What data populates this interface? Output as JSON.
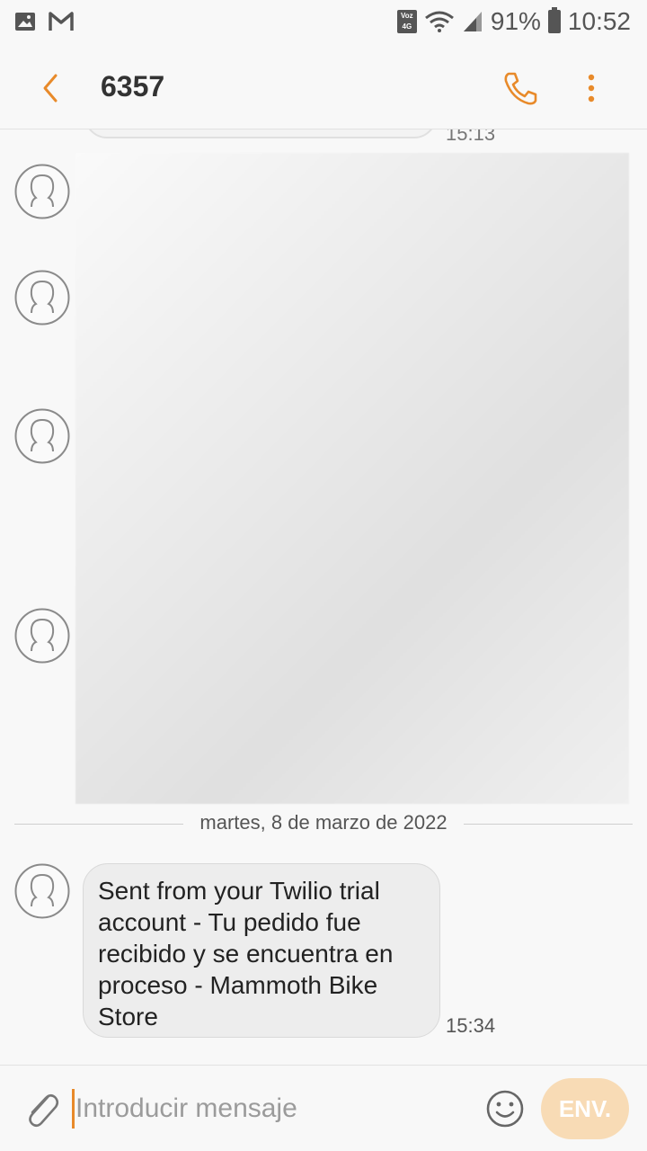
{
  "status_bar": {
    "network_badge": "Voz 4G",
    "battery_percent": "91%",
    "time": "10:52",
    "left_icons": [
      "gallery-icon",
      "gmail-icon"
    ],
    "right_icons": [
      "volte-icon",
      "wifi-icon",
      "signal-icon",
      "battery-icon"
    ]
  },
  "header": {
    "title": "6357",
    "icons": [
      "back-icon",
      "phone-icon",
      "more-icon"
    ]
  },
  "conversation": {
    "previous_time": "15:13",
    "date_divider": "martes, 8 de marzo de 2022",
    "message": {
      "text": "Sent from your Twilio trial account - Tu pedido fue recibido y se encuentra en proceso - Mammoth Bike Store",
      "time": "15:34"
    }
  },
  "composer": {
    "placeholder": "Introducir mensaje",
    "send_label": "ENV.",
    "icons": [
      "attach-icon",
      "emoji-icon"
    ]
  },
  "colors": {
    "accent": "#e88a2a",
    "send_disabled": "#f8dbb5",
    "bubble": "#ededed"
  }
}
